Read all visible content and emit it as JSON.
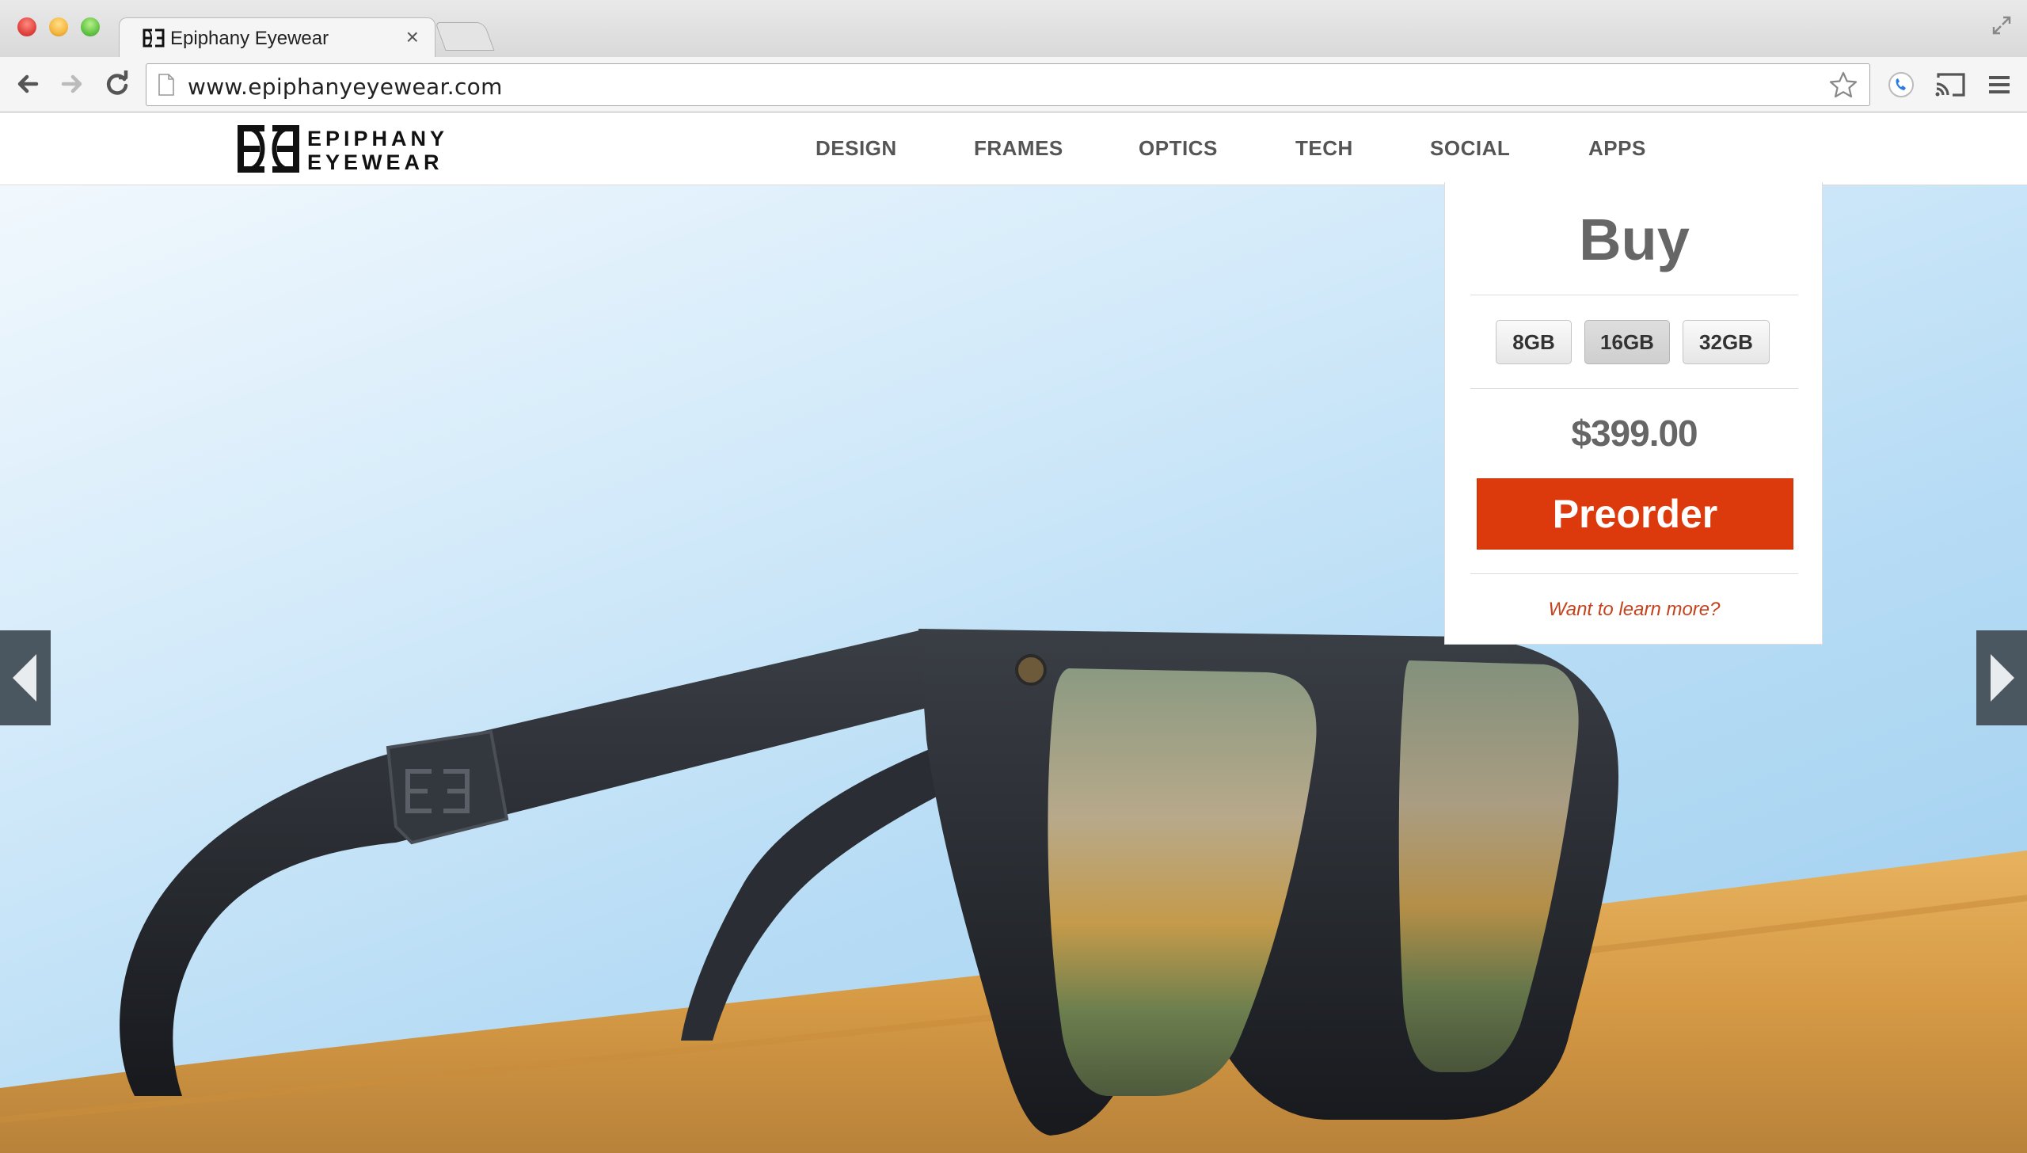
{
  "browser": {
    "tab_title": "Epiphany Eyewear",
    "tab_close": "×",
    "url": "www.epiphanyeyewear.com",
    "icons": [
      "back-icon",
      "forward-icon",
      "reload-icon",
      "page-icon",
      "star-icon",
      "extension-icon",
      "cast-icon",
      "menu-icon",
      "fullscreen-icon"
    ]
  },
  "site": {
    "logo_top": "EPIPHANY",
    "logo_bottom": "EYEWEAR",
    "nav": [
      "DESIGN",
      "FRAMES",
      "OPTICS",
      "TECH",
      "SOCIAL",
      "APPS"
    ]
  },
  "buy_panel": {
    "title": "Buy",
    "capacities": [
      "8GB",
      "16GB",
      "32GB"
    ],
    "selected_capacity": "16GB",
    "price": "$399.00",
    "cta": "Preorder",
    "learn_more": "Want to learn more?"
  },
  "colors": {
    "cta": "#dc3a0d",
    "link": "#c4431c",
    "arrow_bg": "#4a5660"
  }
}
